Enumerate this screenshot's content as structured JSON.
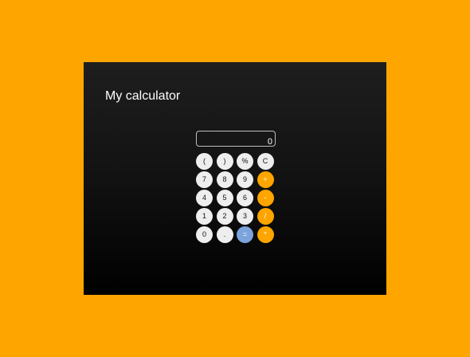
{
  "app": {
    "title": "My calculator"
  },
  "display": {
    "value": "0"
  },
  "colors": {
    "page_background": "#ffa500",
    "operator_key": "#ffa500",
    "equals_key": "#7ba3dc",
    "number_key": "#eeeeee"
  },
  "keys": [
    {
      "label": "(",
      "type": "num"
    },
    {
      "label": ")",
      "type": "num"
    },
    {
      "label": "%",
      "type": "num"
    },
    {
      "label": "C",
      "type": "num"
    },
    {
      "label": "7",
      "type": "num"
    },
    {
      "label": "8",
      "type": "num"
    },
    {
      "label": "9",
      "type": "num"
    },
    {
      "label": "+",
      "type": "op"
    },
    {
      "label": "4",
      "type": "num"
    },
    {
      "label": "5",
      "type": "num"
    },
    {
      "label": "6",
      "type": "num"
    },
    {
      "label": "-",
      "type": "op"
    },
    {
      "label": "1",
      "type": "num"
    },
    {
      "label": "2",
      "type": "num"
    },
    {
      "label": "3",
      "type": "num"
    },
    {
      "label": "/",
      "type": "op"
    },
    {
      "label": "0",
      "type": "num"
    },
    {
      "label": ".",
      "type": "num"
    },
    {
      "label": "=",
      "type": "eq"
    },
    {
      "label": "*",
      "type": "op"
    }
  ]
}
